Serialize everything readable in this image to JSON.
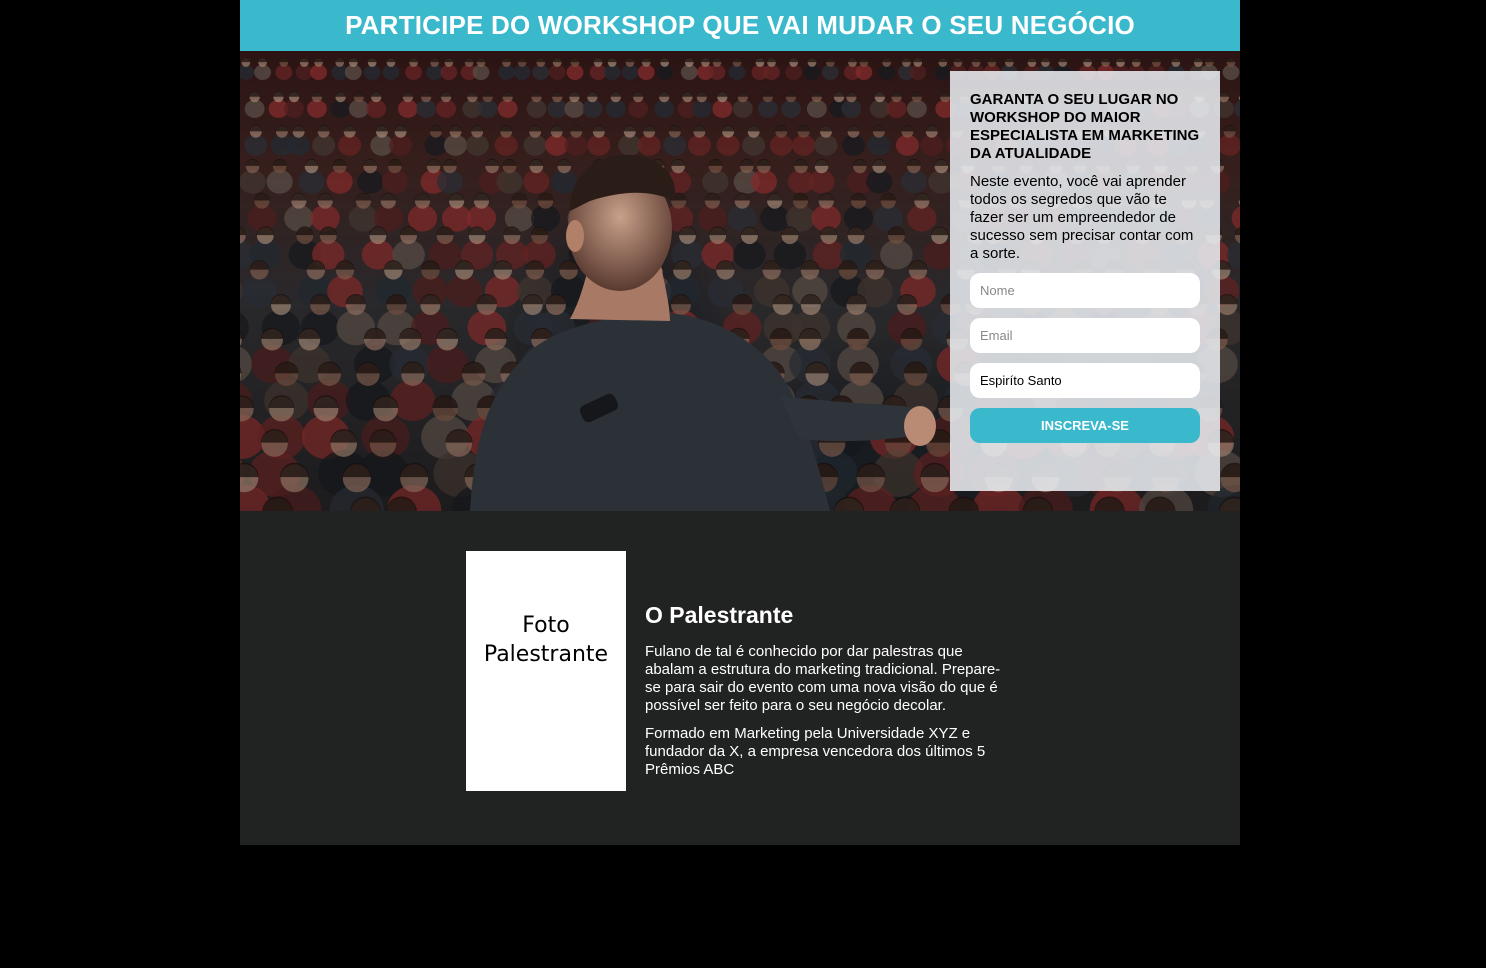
{
  "banner": {
    "headline": "PARTICIPE DO WORKSHOP QUE VAI MUDAR O SEU NEGÓCIO"
  },
  "form": {
    "title": "GARANTA O SEU LUGAR NO WORKSHOP DO MAIOR ESPECIALISTA EM MARKETING DA ATUALIDADE",
    "description": "Neste evento, você vai aprender todos os segredos que vão te fazer ser um empreendedor de sucesso sem precisar contar com a sorte.",
    "name_placeholder": "Nome",
    "email_placeholder": "Email",
    "state_selected": "Espiríto Santo",
    "submit_label": "INSCREVA-SE"
  },
  "about": {
    "photo_label": "Foto Palestrante",
    "title": "O Palestrante",
    "paragraph_1": "Fulano de tal é conhecido por dar palestras que abalam a estrutura do marketing tradicional. Prepare-se para sair do evento com uma nova visão do que é possível ser feito para o seu negócio decolar.",
    "paragraph_2": "Formado em Marketing pela Universidade XYZ e fundador da X, a empresa vencedora dos últimos 5 Prêmios ABC"
  },
  "colors": {
    "accent": "#3ab8cc",
    "about_bg": "#212222",
    "page_bg": "#000000"
  }
}
